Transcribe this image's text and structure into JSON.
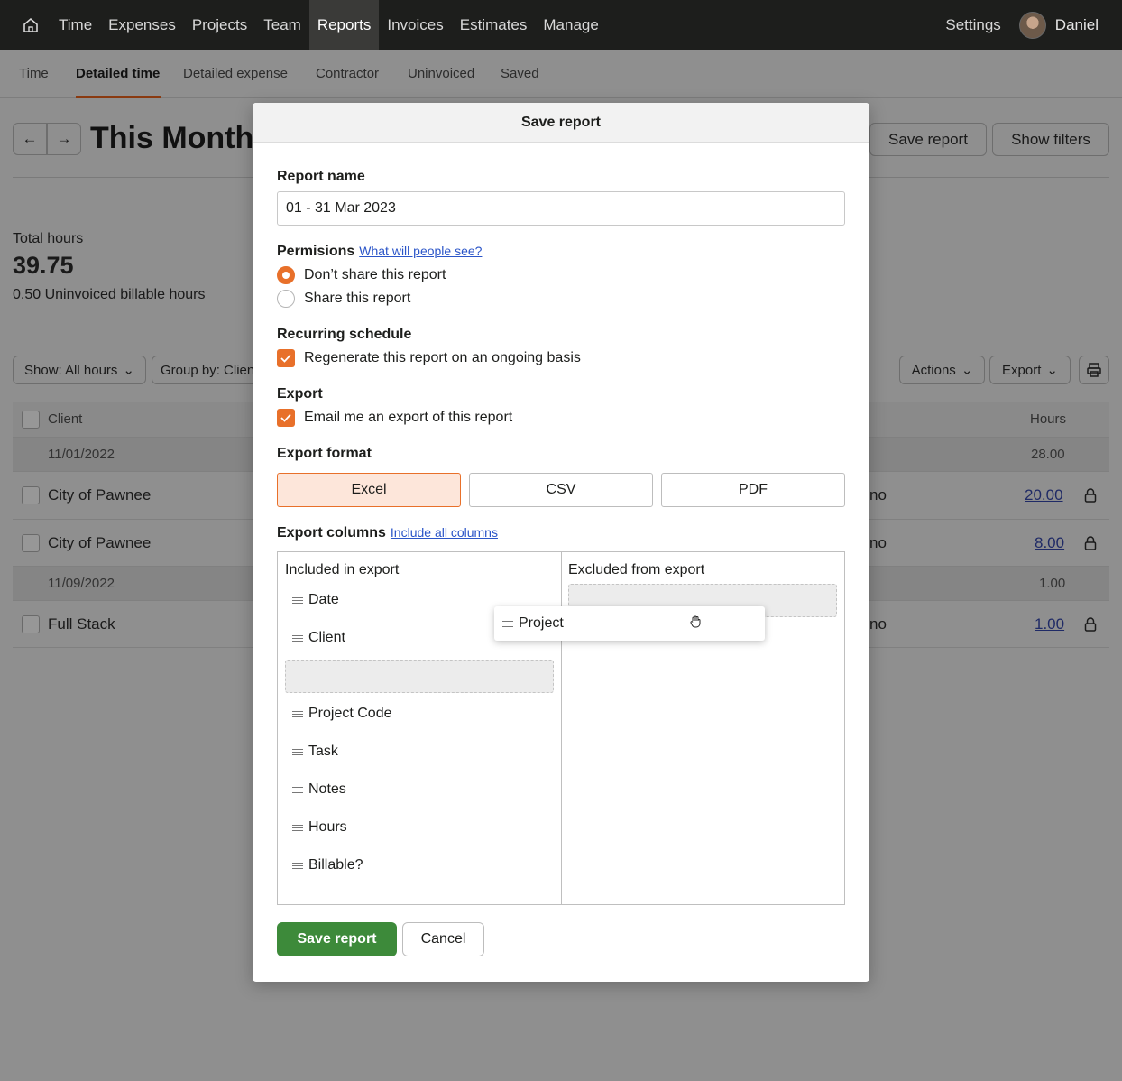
{
  "nav": {
    "items": [
      "Time",
      "Expenses",
      "Projects",
      "Team",
      "Reports",
      "Invoices",
      "Estimates",
      "Manage"
    ],
    "active": "Reports",
    "settings": "Settings",
    "user": "Daniel"
  },
  "subnav": {
    "items": [
      "Time",
      "Detailed time",
      "Detailed expense",
      "Contractor",
      "Uninvoiced",
      "Saved"
    ],
    "active": "Detailed time"
  },
  "page": {
    "title": "This Month",
    "save_report": "Save report",
    "show_filters": "Show filters",
    "total_hours_label": "Total hours",
    "total_hours": "39.75",
    "uninvoiced": "0.50 Uninvoiced billable hours",
    "show_filter": "Show: All hours",
    "group_by": "Group by: Clien",
    "actions": "Actions",
    "export": "Export",
    "col_client": "Client",
    "col_hours": "Hours",
    "rows": [
      {
        "type": "date",
        "label": "11/01/2022",
        "hours": "28.00"
      },
      {
        "type": "entry",
        "client": "City of Pawnee",
        "mid": "no",
        "hours": "20.00"
      },
      {
        "type": "entry",
        "client": "City of Pawnee",
        "mid": "no",
        "hours": "8.00"
      },
      {
        "type": "date",
        "label": "11/09/2022",
        "hours": "1.00"
      },
      {
        "type": "entry",
        "client": "Full Stack",
        "mid": "no",
        "hours": "1.00"
      }
    ]
  },
  "modal": {
    "title": "Save report",
    "report_name_label": "Report name",
    "report_name": "01 - 31 Mar 2023",
    "permissions_label": "Permisions",
    "permissions_link": "What will people see?",
    "perm_options": [
      "Don’t share this report",
      "Share this report"
    ],
    "recurring_label": "Recurring schedule",
    "recurring_option": "Regenerate this report on an ongoing basis",
    "export_label": "Export",
    "export_option": "Email me an export of this report",
    "format_label": "Export format",
    "formats": [
      "Excel",
      "CSV",
      "PDF"
    ],
    "selected_format": "Excel",
    "columns_label": "Export columns",
    "columns_link": "Include all columns",
    "included_label": "Included in export",
    "excluded_label": "Excluded from export",
    "included_top": [
      "Date",
      "Client"
    ],
    "included_bottom": [
      "Project Code",
      "Task",
      "Notes",
      "Hours",
      "Billable?"
    ],
    "dragging": "Project",
    "save_button": "Save report",
    "cancel_button": "Cancel"
  },
  "colors": {
    "accent": "#e8702a",
    "save_green": "#3d8a3a",
    "link_blue": "#2b55c8",
    "nav_bg": "#1d1e1c"
  }
}
